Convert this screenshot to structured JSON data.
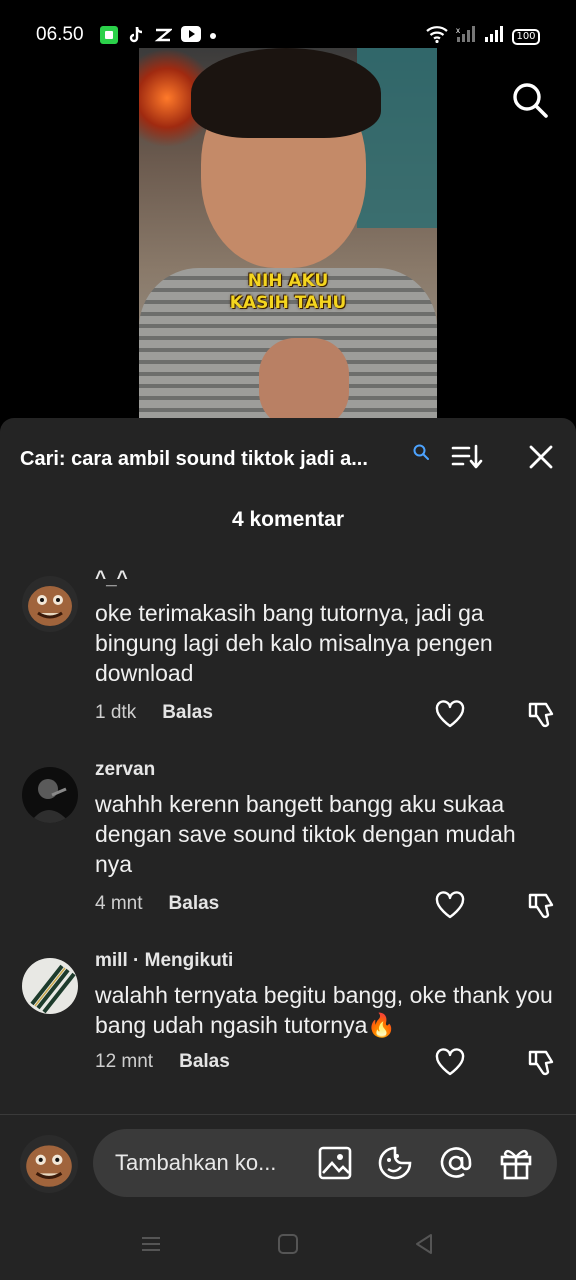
{
  "status_bar": {
    "time": "06.50",
    "battery": "100",
    "apps": [
      "chat-app-icon",
      "tiktok-icon",
      "capcut-icon",
      "youtube-icon",
      "dot-icon"
    ]
  },
  "video": {
    "caption_line1": "NIH AKU",
    "caption_line2": "KASIH TAHU"
  },
  "comments_sheet": {
    "search_query": "Cari: cara ambil sound tiktok jadi a...",
    "count_label": "4 komentar",
    "reply_label": "Balas",
    "comments": [
      {
        "user": "^_^",
        "text": "oke terimakasih bang tutornya, jadi ga bingung lagi deh kalo misalnya pengen download",
        "time": "1 dtk"
      },
      {
        "user": "zervan",
        "text": "wahhh kerenn bangett bangg aku sukaa dengan save sound tiktok dengan mudah nya",
        "time": "4 mnt"
      },
      {
        "user": "mill · Mengikuti",
        "text": "walahh ternyata begitu bangg, oke thank you bang udah ngasih tutornya🔥",
        "time": "12 mnt"
      }
    ]
  },
  "composer": {
    "placeholder": "Tambahkan ko..."
  },
  "colors": {
    "sheet_bg": "#242424",
    "pill_bg": "#3a3a3a",
    "caption": "#f4d51f"
  }
}
